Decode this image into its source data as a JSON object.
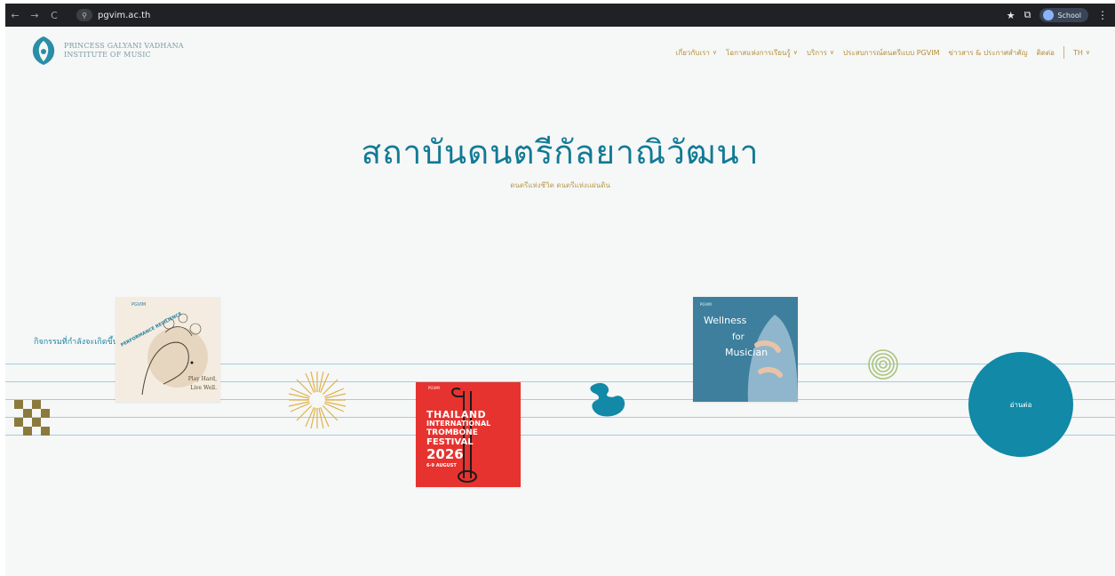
{
  "browser": {
    "url": "pgvim.ac.th",
    "profile": "School",
    "back_icon": "←",
    "forward_icon": "→",
    "reload_icon": "C",
    "site_icon": "⚲",
    "star_icon": "★",
    "extension_icon": "⧉",
    "menu_icon": "⋮"
  },
  "logo": {
    "line1": "PRINCESS GALYANI VADHANA",
    "line2": "INSTITUTE OF MUSIC"
  },
  "nav": {
    "items": [
      {
        "label": "เกี่ยวกับเรา",
        "chevron": "∨"
      },
      {
        "label": "โอกาสแห่งการเรียนรู้",
        "chevron": "∨"
      },
      {
        "label": "บริการ",
        "chevron": "∨"
      },
      {
        "label": "ประสบการณ์ดนตรีแบบ PGVIM"
      },
      {
        "label": "ข่าวสาร & ประกาศสำคัญ"
      },
      {
        "label": "ติดต่อ"
      }
    ],
    "language": "TH",
    "language_chevron": "∨"
  },
  "hero": {
    "title": "สถาบันดนตรีกัลยาณิวัฒนา",
    "subtitle": "ดนตรีแห่งชีวิต ดนตรีแห่งแผ่นดิน"
  },
  "events": {
    "label": "กิจกรรมที่กำลังจะเกิดขึ้น",
    "read_more": "อ่านต่อ"
  },
  "cards": [
    {
      "brand": "PGVIM",
      "title": "PERFORMANCE RESILIENCE",
      "caption1": "Play Hard,",
      "caption2": "Live Well."
    },
    {
      "brand": "PGVIM",
      "line1": "THAILAND",
      "line2": "INTERNATIONAL",
      "line3": "TROMBONE",
      "line4": "FESTIVAL",
      "line5": "2026",
      "line6": "6-9 AUGUST"
    },
    {
      "brand": "PGVIM",
      "line1": "Wellness",
      "line2": "for",
      "line3": "Musician"
    }
  ],
  "colors": {
    "accent_teal": "#127a95",
    "gold": "#b38f39",
    "staff_line": "#9fd0df",
    "read_more_circle": "#1189a7",
    "card_red": "#e6332f"
  }
}
